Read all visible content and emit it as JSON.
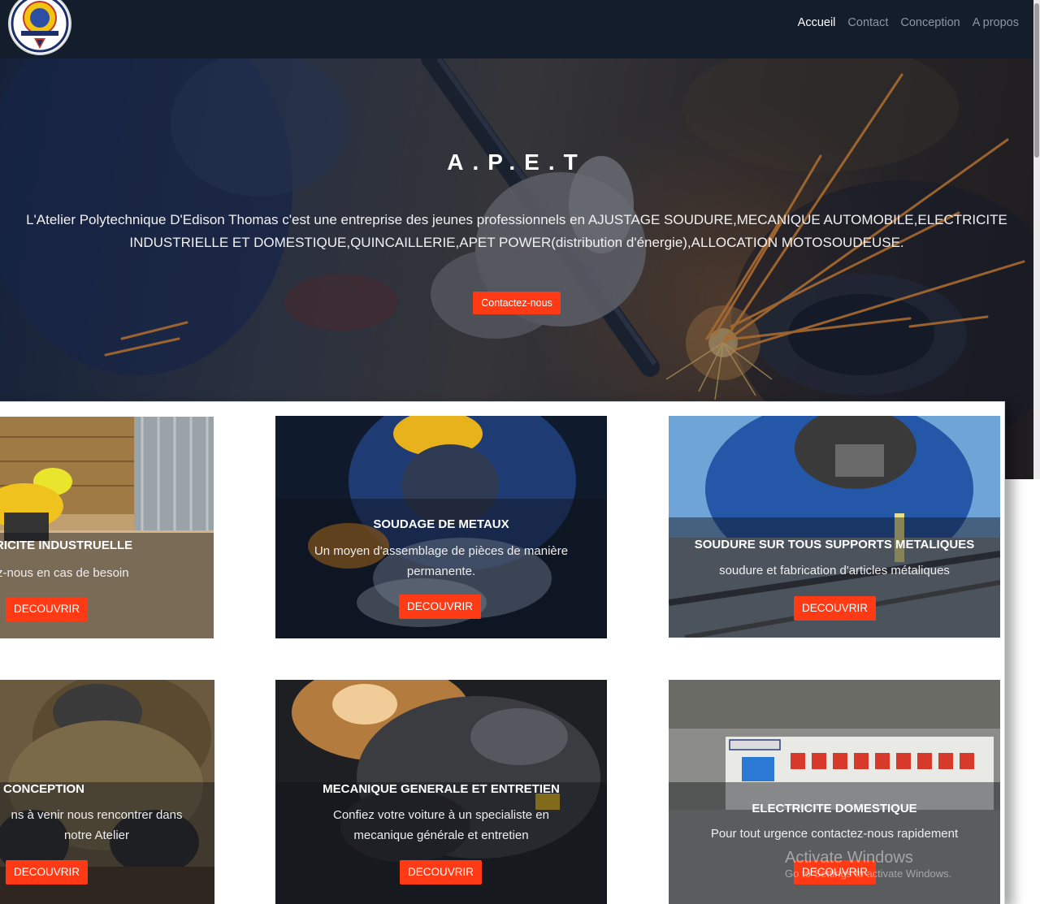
{
  "nav": {
    "items": [
      {
        "label": "Accueil",
        "active": true
      },
      {
        "label": "Contact",
        "active": false
      },
      {
        "label": "Conception",
        "active": false
      },
      {
        "label": "A propos",
        "active": false
      }
    ]
  },
  "hero": {
    "title": "A.P.E.T",
    "description": "L'Atelier Polytechnique D'Edison Thomas c'est une entreprise des jeunes professionnels en AJUSTAGE SOUDURE,MECANIQUE AUTOMOBILE,ELECTRICITE INDUSTRIELLE ET DOMESTIQUE,QUINCAILLERIE,APET POWER(distribution d'énergie),ALLOCATION MOTOSOUDEUSE.",
    "button_label": "Contactez-nous"
  },
  "cards": [
    {
      "title": "RICITE INDUSTRUELLE",
      "description": "z-nous en cas de besoin",
      "button": "DECOUVRIR"
    },
    {
      "title": "SOUDAGE DE METAUX",
      "description": "Un moyen d'assemblage de pièces de manière permanente.",
      "button": "DECOUVRIR"
    },
    {
      "title": "SOUDURE SUR TOUS SUPPORTS METALIQUES",
      "description": "soudure et fabrication d'articles métaliques",
      "button": "DECOUVRIR"
    },
    {
      "title": "CONCEPTION",
      "description": "ns à venir nous rencontrer dans notre Atelier",
      "button": "DECOUVRIR"
    },
    {
      "title": "MECANIQUE GENERALE ET ENTRETIEN",
      "description": "Confiez votre voiture à un specialiste en mecanique générale et entretien",
      "button": "DECOUVRIR"
    },
    {
      "title": "ELECTRICITE DOMESTIQUE",
      "description": "Pour tout urgence contactez-nous rapidement",
      "button": "DECOUVRIR"
    }
  ],
  "watermark": {
    "line1": "Activate Windows",
    "line2": "Go to Settings to activate Windows."
  },
  "colors": {
    "navbar": "#131d2b",
    "accent": "#ff3a14",
    "nav_link": "#8c96a5",
    "nav_active": "#ffffff"
  }
}
